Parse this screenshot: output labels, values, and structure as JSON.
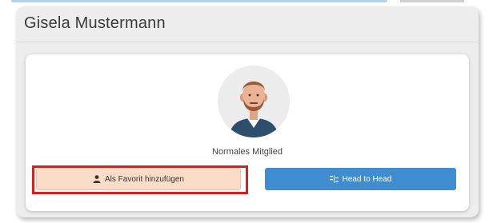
{
  "profile": {
    "name": "Gisela Mustermann",
    "role": "Normales Mitglied"
  },
  "actions": {
    "favorite_label": "Als Favorit hinzufügen",
    "favorite_icon": "user-icon",
    "h2h_label": "Head to Head",
    "h2h_icon": "compare-icon"
  },
  "colors": {
    "favorite_bg": "#fbdcc6",
    "h2h_bg": "#3f8dd0",
    "highlight": "#d62020",
    "avatar_bg": "#ececec",
    "jacket": "#2e4e6e"
  }
}
